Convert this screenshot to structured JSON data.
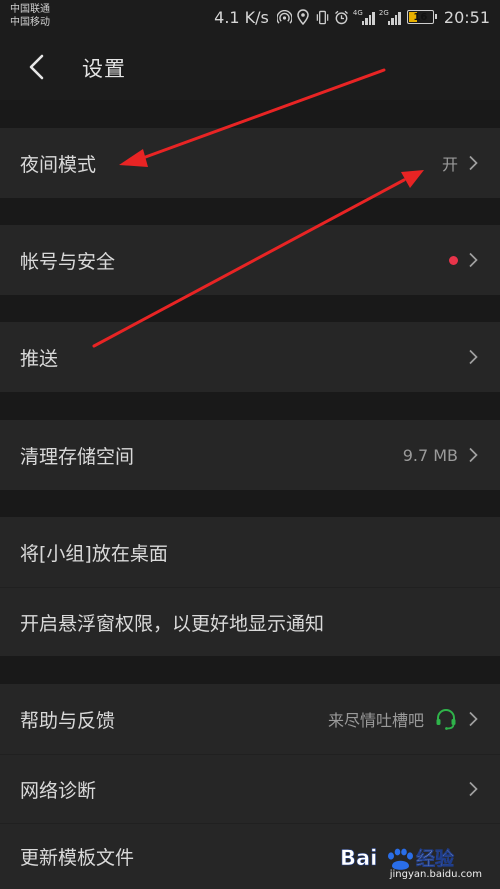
{
  "status_bar": {
    "carrier_1": "中国联通",
    "carrier_2": "中国移动",
    "speed": "4.1 K/s",
    "signal_1_tag": "4G",
    "signal_2_tag": "2G",
    "battery": "16",
    "time": "20:51",
    "icons": [
      "hotspot-icon",
      "location-icon",
      "vibrate-icon",
      "alarm-icon",
      "signal-icon",
      "signal-icon",
      "battery-icon"
    ]
  },
  "header": {
    "title": "设置"
  },
  "settings": {
    "night_mode": {
      "label": "夜间模式",
      "value": "开"
    },
    "account_security": {
      "label": "帐号与安全",
      "badge_color": "#e8344a"
    },
    "push": {
      "label": "推送"
    },
    "clear_storage": {
      "label": "清理存储空间",
      "value": "9.7 MB"
    },
    "shortcut": {
      "label": "将[小组]放在桌面"
    },
    "float_window": {
      "label": "开启悬浮窗权限，以更好地显示通知"
    },
    "help_feedback": {
      "label": "帮助与反馈",
      "value": "来尽情吐槽吧"
    },
    "network_diagnosis": {
      "label": "网络诊断"
    },
    "update_template": {
      "label": "更新模板文件"
    }
  },
  "colors": {
    "background": "#191919",
    "row": "#262626",
    "arrow": "#e82424",
    "headset": "#2fb34a"
  },
  "watermark": {
    "brand": "Bai经验",
    "url": "jingyan.baidu.com"
  }
}
